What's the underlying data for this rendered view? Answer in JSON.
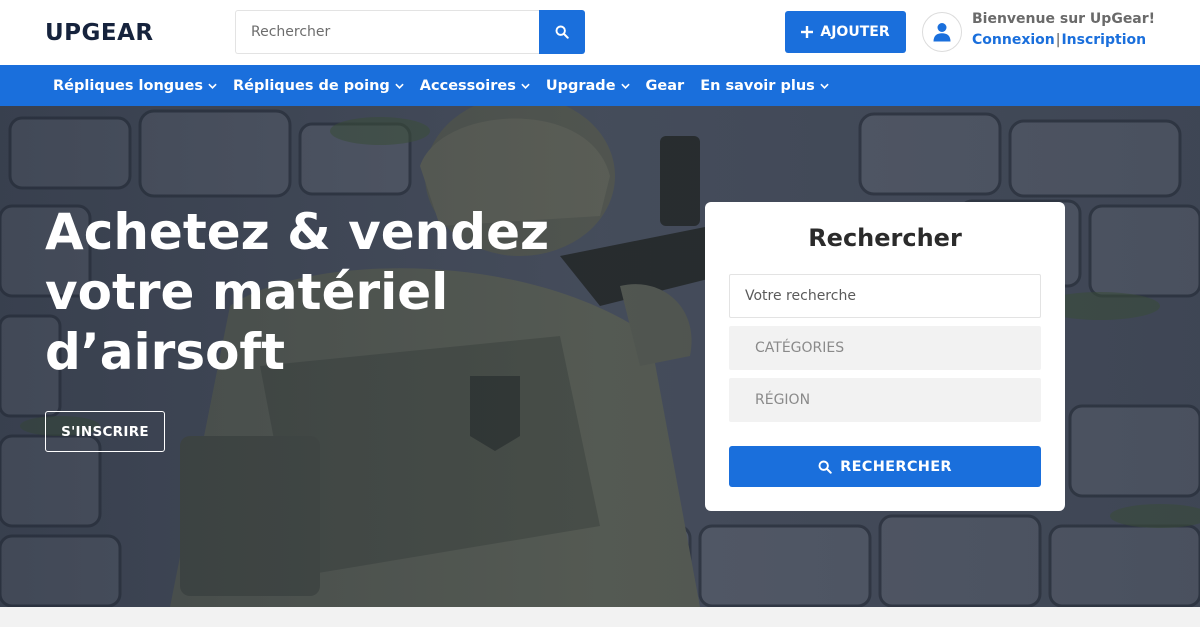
{
  "brand": {
    "logo_text": "UPGEAR",
    "primary_color": "#1a6fdc",
    "dark_color": "#16233d"
  },
  "header": {
    "search": {
      "placeholder": "Rechercher",
      "button_icon": "search-icon"
    },
    "add_button": {
      "label": "AJOUTER",
      "icon": "plus-icon"
    },
    "user": {
      "avatar_icon": "user-icon",
      "welcome": "Bienvenue sur UpGear!",
      "login_label": "Connexion",
      "separator": "|",
      "signup_label": "Inscription"
    }
  },
  "nav": {
    "items": [
      {
        "label": "Répliques longues",
        "has_dropdown": true
      },
      {
        "label": "Répliques de poing",
        "has_dropdown": true
      },
      {
        "label": "Accessoires",
        "has_dropdown": true
      },
      {
        "label": "Upgrade",
        "has_dropdown": true
      },
      {
        "label": "Gear",
        "has_dropdown": false
      },
      {
        "label": "En savoir plus",
        "has_dropdown": true
      }
    ]
  },
  "hero": {
    "title_lines": [
      "Achetez & vendez",
      "votre matériel",
      "d’airsoft"
    ],
    "signup_button": "S'INSCRIRE"
  },
  "search_card": {
    "title": "Rechercher",
    "query_placeholder": "Votre recherche",
    "category_select": "CATÉGORIES",
    "region_select": "RÉGION",
    "submit_label": "RECHERCHER",
    "submit_icon": "search-icon"
  }
}
